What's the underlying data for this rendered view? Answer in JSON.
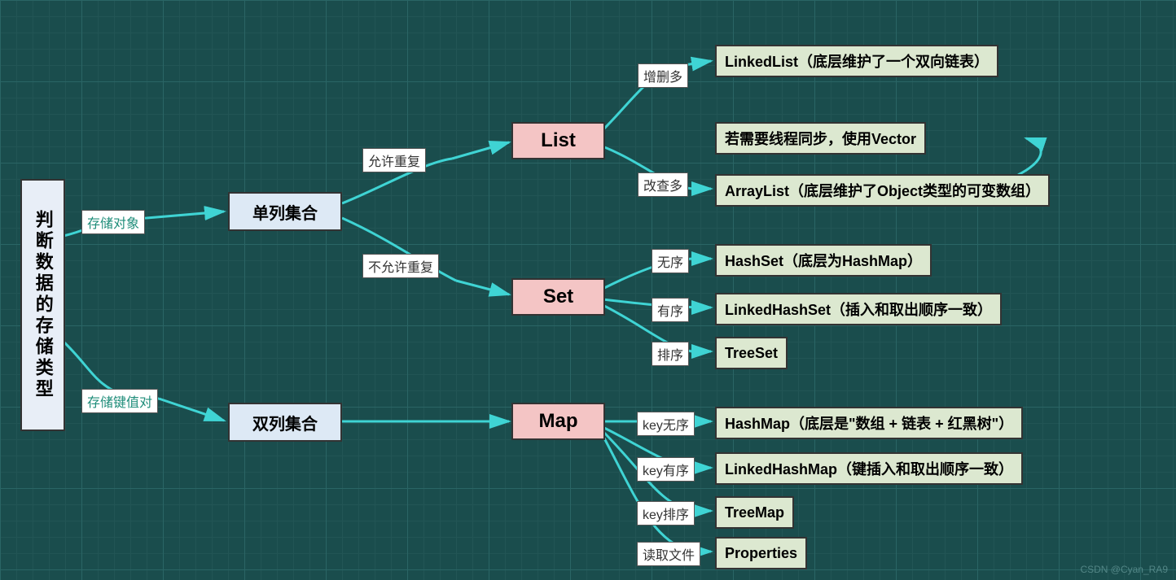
{
  "root": "判断数据的存储类型",
  "edge_labels": {
    "store_object": "存储对象",
    "store_kv": "存储键值对",
    "allow_dup": "允许重复",
    "no_dup": "不允许重复",
    "more_add_del": "增删多",
    "more_mod_query": "改查多",
    "unordered": "无序",
    "ordered": "有序",
    "sorted": "排序",
    "key_unordered": "key无序",
    "key_ordered": "key有序",
    "key_sorted": "key排序",
    "read_file": "读取文件"
  },
  "nodes": {
    "single": "单列集合",
    "double": "双列集合",
    "list": "List",
    "set": "Set",
    "map": "Map",
    "linkedlist": "LinkedList（底层维护了一个双向链表）",
    "vector": "若需要线程同步，使用Vector",
    "arraylist": "ArrayList（底层维护了Object类型的可变数组）",
    "hashset": "HashSet（底层为HashMap）",
    "linkedhashset": "LinkedHashSet（插入和取出顺序一致）",
    "treeset": "TreeSet",
    "hashmap": "HashMap（底层是\"数组 + 链表 + 红黑树\"）",
    "linkedhashmap": "LinkedHashMap（键插入和取出顺序一致）",
    "treemap": "TreeMap",
    "properties": "Properties"
  },
  "watermark": "CSDN @Cyan_RA9"
}
